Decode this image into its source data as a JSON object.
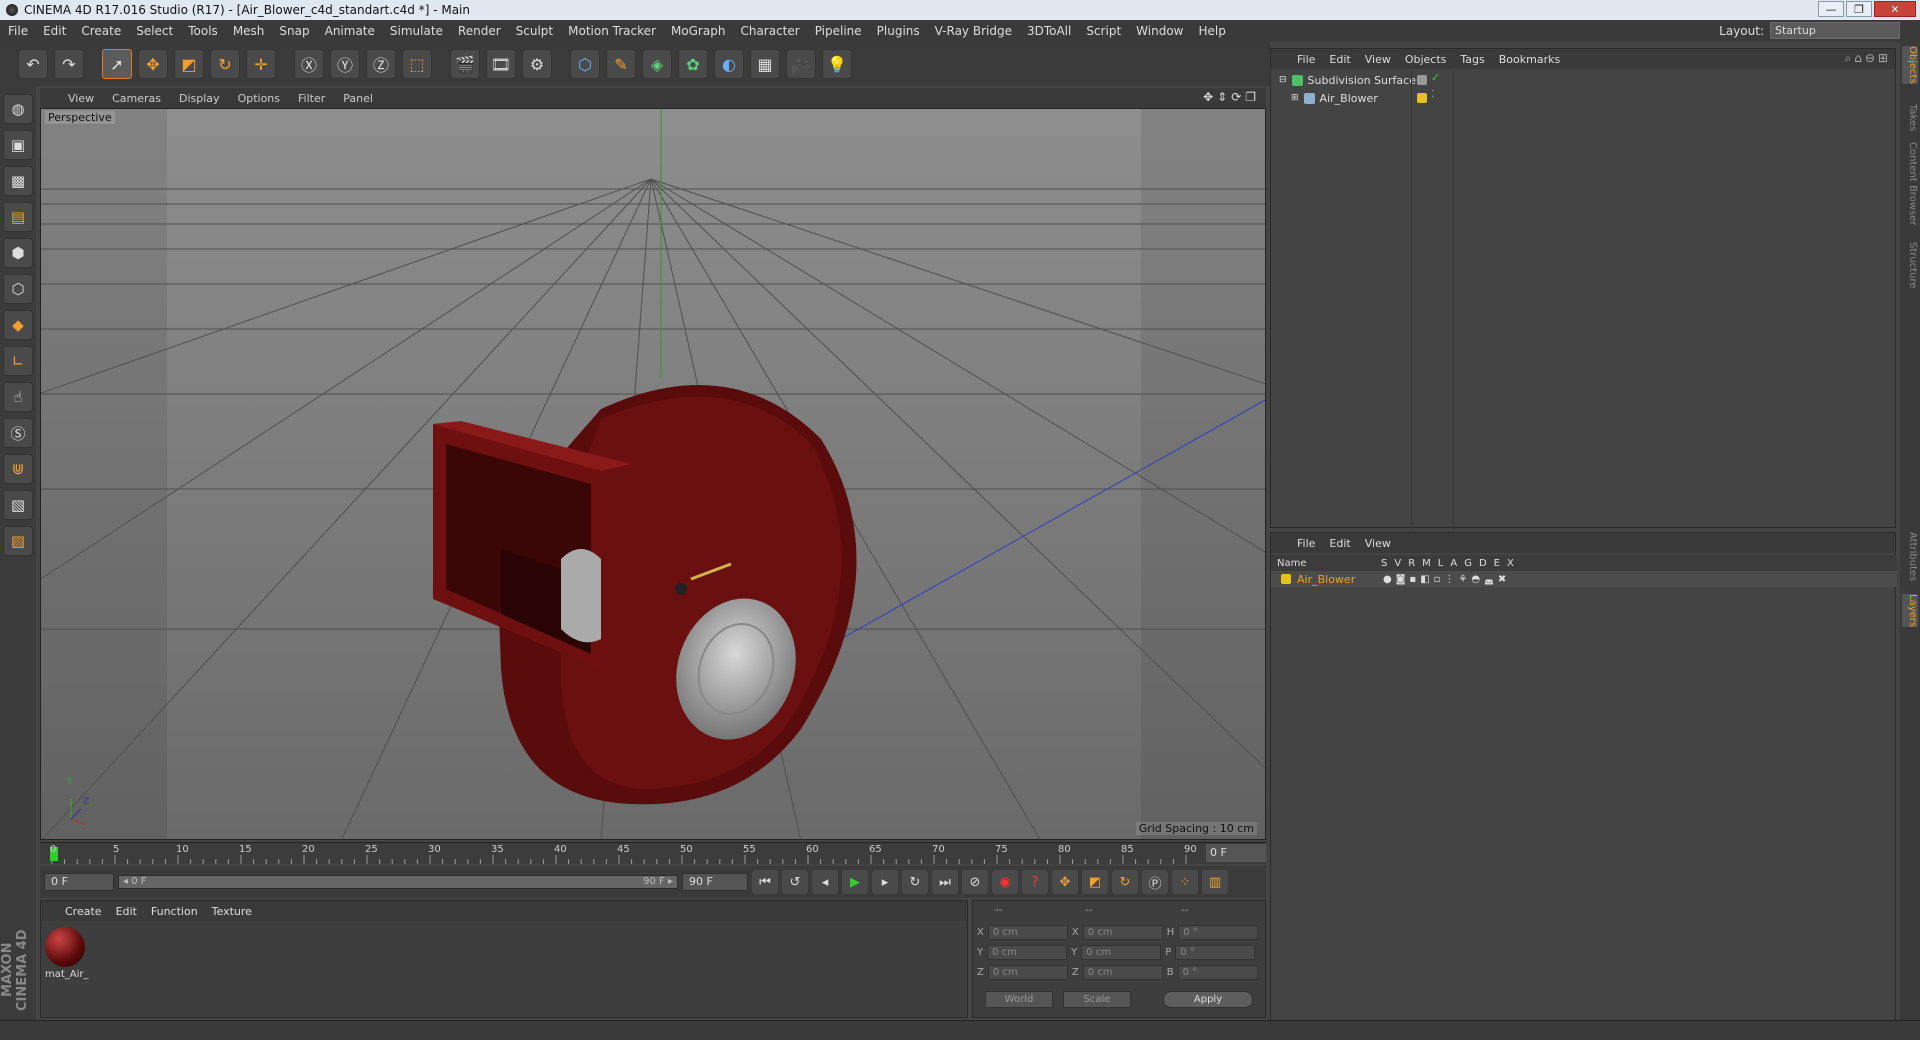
{
  "window": {
    "title": "CINEMA 4D R17.016 Studio (R17) - [Air_Blower_c4d_standart.c4d *] - Main",
    "min": "—",
    "max": "❐",
    "close": "✕"
  },
  "menu": [
    "File",
    "Edit",
    "Create",
    "Select",
    "Tools",
    "Mesh",
    "Snap",
    "Animate",
    "Simulate",
    "Render",
    "Sculpt",
    "Motion Tracker",
    "MoGraph",
    "Character",
    "Pipeline",
    "Plugins",
    "V-Ray Bridge",
    "3DToAll",
    "Script",
    "Window",
    "Help"
  ],
  "layout": {
    "label": "Layout:",
    "value": "Startup"
  },
  "viewport": {
    "menu": [
      "View",
      "Cameras",
      "Display",
      "Options",
      "Filter",
      "Panel"
    ],
    "label": "Perspective",
    "grid_spacing": "Grid Spacing : 10 cm",
    "axis_y": "Y",
    "axis_z": "Z"
  },
  "timeline": {
    "ticks": [
      "0",
      "5",
      "10",
      "15",
      "20",
      "25",
      "30",
      "35",
      "40",
      "45",
      "50",
      "55",
      "60",
      "65",
      "70",
      "75",
      "80",
      "85",
      "90"
    ],
    "end_frame": "0 F"
  },
  "playbar": {
    "current": "0 F",
    "range_start": "◂ 0 F",
    "range_end": "90 F ▸",
    "max": "90 F"
  },
  "material_panel": {
    "menu": [
      "Create",
      "Edit",
      "Function",
      "Texture"
    ],
    "materials": [
      {
        "name": "mat_Air_"
      }
    ]
  },
  "coords": {
    "header": [
      "--",
      "--",
      "--"
    ],
    "rows": [
      {
        "a": "X",
        "av": "0 cm",
        "b": "X",
        "bv": "0 cm",
        "c": "H",
        "cv": "0 °"
      },
      {
        "a": "Y",
        "av": "0 cm",
        "b": "Y",
        "bv": "0 cm",
        "c": "P",
        "cv": "0 °"
      },
      {
        "a": "Z",
        "av": "0 cm",
        "b": "Z",
        "bv": "0 cm",
        "c": "B",
        "cv": "0 °"
      }
    ],
    "world": "World",
    "scale": "Scale",
    "apply": "Apply"
  },
  "object_panel": {
    "menu": [
      "File",
      "Edit",
      "View",
      "Objects",
      "Tags",
      "Bookmarks"
    ],
    "objects": [
      {
        "name": "Subdivision Surface",
        "color": "#4fc06a"
      },
      {
        "name": "Air_Blower",
        "color": "#8fb0d0"
      }
    ]
  },
  "layer_panel": {
    "menu": [
      "File",
      "Edit",
      "View"
    ],
    "head_name": "Name",
    "columns": [
      "S",
      "V",
      "R",
      "M",
      "L",
      "A",
      "G",
      "D",
      "E",
      "X"
    ],
    "layers": [
      {
        "name": "Air_Blower",
        "color": "#e8c21a"
      }
    ]
  },
  "right_tabs": [
    "Objects",
    "Takes",
    "Content Browser",
    "Structure",
    "Attributes",
    "Layers"
  ],
  "maxon": "MAXON CINEMA 4D",
  "colors": {
    "accent": "#f0a020",
    "bg": "#444444"
  }
}
